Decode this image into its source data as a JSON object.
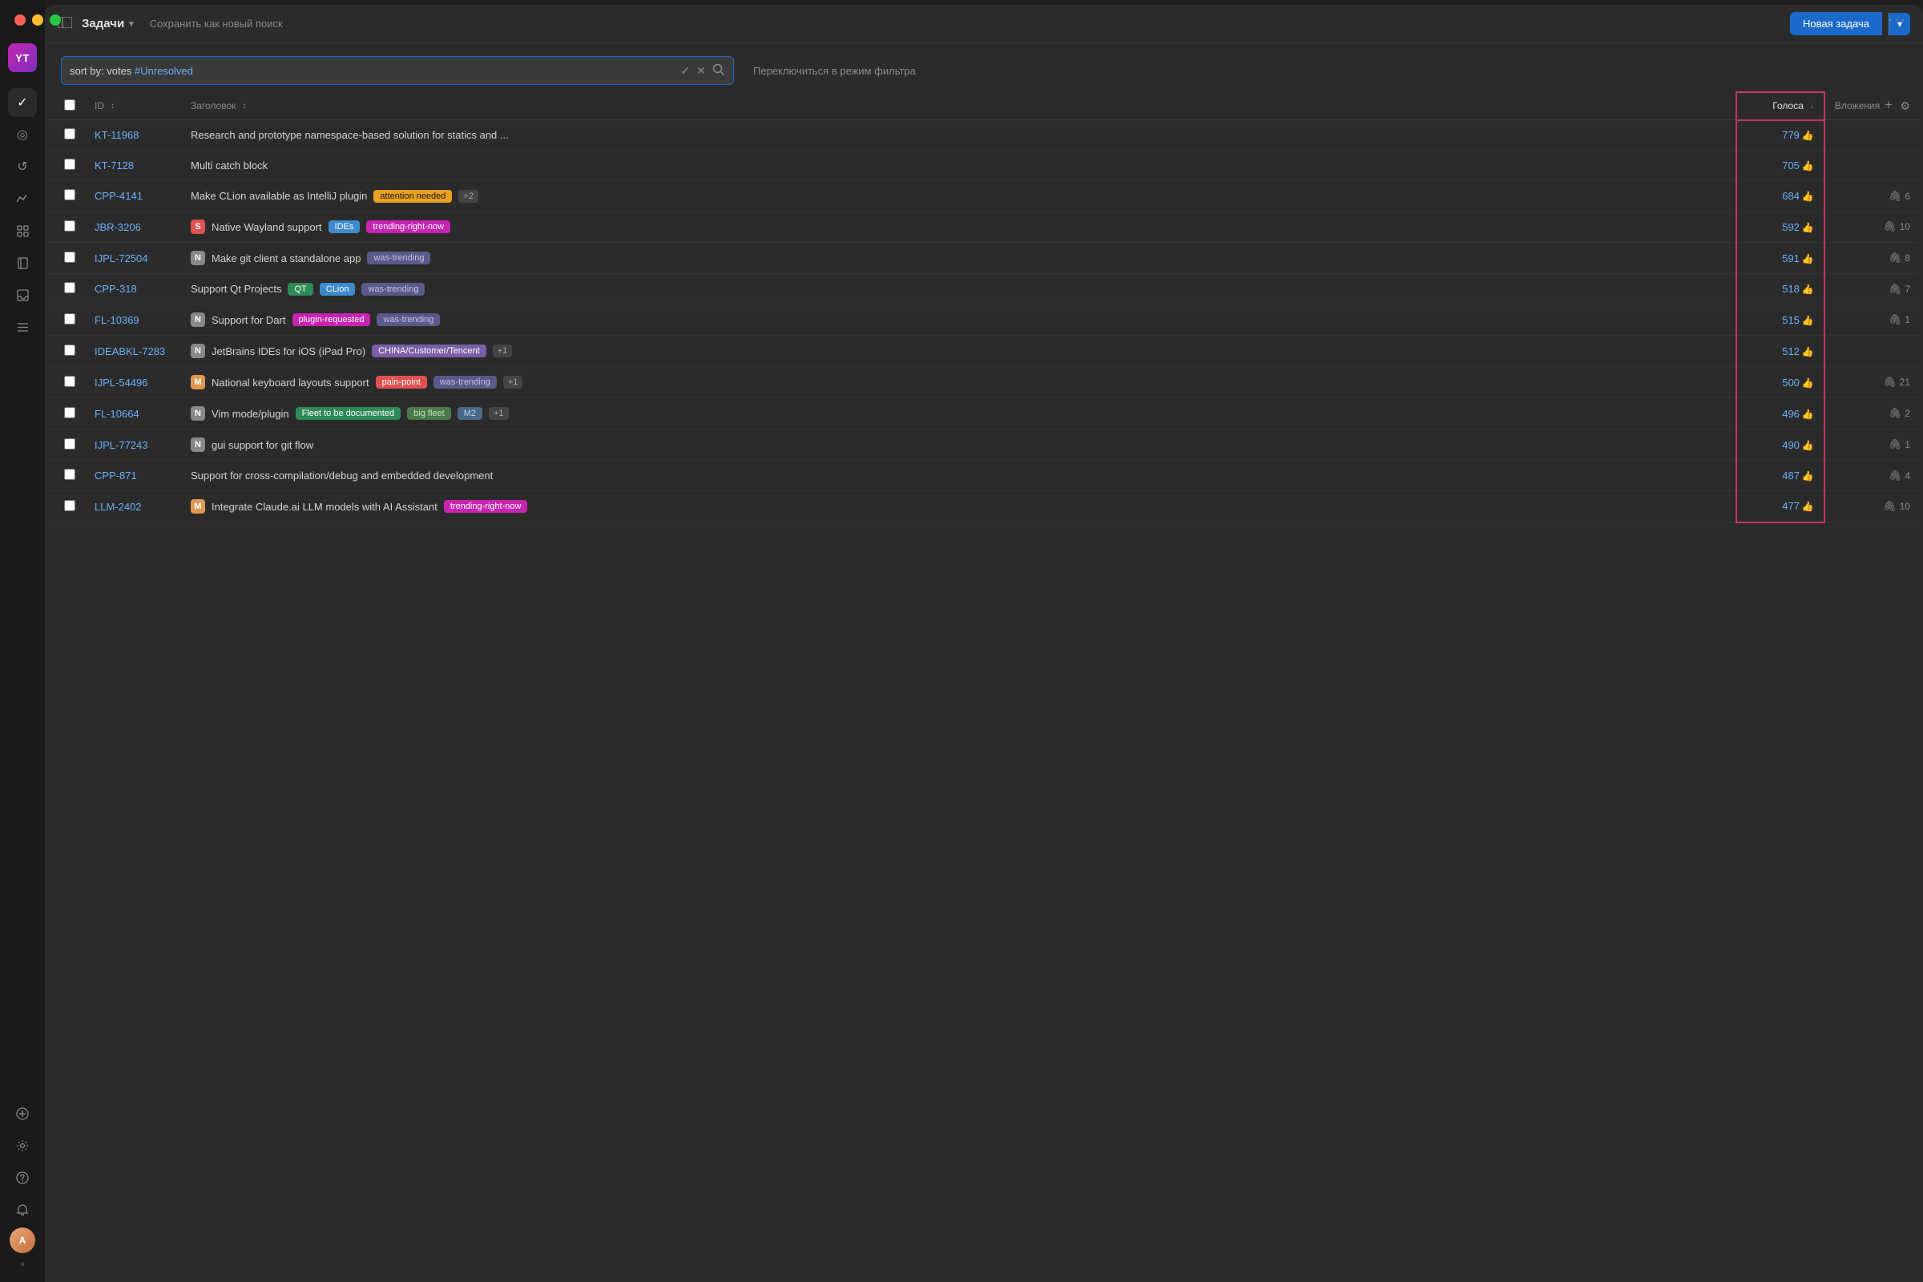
{
  "window": {
    "traffic_lights": [
      "red",
      "yellow",
      "green"
    ]
  },
  "nav": {
    "logo_text": "YT",
    "icons": [
      {
        "name": "checkmark",
        "symbol": "✓",
        "active": true
      },
      {
        "name": "circle",
        "symbol": "◉",
        "active": false
      },
      {
        "name": "history",
        "symbol": "↺",
        "active": false
      },
      {
        "name": "chart",
        "symbol": "⚡",
        "active": false
      },
      {
        "name": "grid",
        "symbol": "⊞",
        "active": false
      },
      {
        "name": "book",
        "symbol": "📖",
        "active": false
      },
      {
        "name": "inbox",
        "symbol": "⊟",
        "active": false
      },
      {
        "name": "stack",
        "symbol": "≡",
        "active": false
      }
    ],
    "bottom_icons": [
      {
        "name": "plus",
        "symbol": "+"
      },
      {
        "name": "settings",
        "symbol": "⚙"
      },
      {
        "name": "question",
        "symbol": "?"
      },
      {
        "name": "bell",
        "symbol": "🔔"
      }
    ],
    "user_initials": "A",
    "expand_icon": "»"
  },
  "topbar": {
    "sidebar_toggle": "⊟",
    "view_title": "Задачи",
    "chevron": "▾",
    "save_search_label": "Сохранить как новый поиск",
    "new_task_label": "Новая задача",
    "new_task_arrow": "▾"
  },
  "search": {
    "query_prefix": "sort by: votes ",
    "query_keyword": "#Unresolved",
    "checkmark_icon": "✓",
    "clear_icon": "✕",
    "search_icon": "🔍",
    "filter_switch_label": "Переключиться в режим фильтра"
  },
  "table": {
    "columns": {
      "checkbox": "",
      "id": "ID",
      "id_sort": "↕",
      "title": "Заголовок",
      "title_sort": "↕",
      "votes": "Голоса",
      "votes_sort": "↓",
      "attach": "Вложения",
      "add": "+",
      "gear": "⚙"
    },
    "rows": [
      {
        "id": "KT-11968",
        "title": "Research and prototype namespace-based solution for statics and ...",
        "tags": [],
        "priority": null,
        "votes": "779",
        "attach": null
      },
      {
        "id": "KT-7128",
        "title": "Multi catch block",
        "tags": [],
        "priority": null,
        "votes": "705",
        "attach": null
      },
      {
        "id": "CPP-4141",
        "title": "Make CLion available as IntelliJ plugin",
        "tags": [
          {
            "label": "attention needed",
            "type": "attention"
          },
          {
            "label": "+2",
            "type": "count"
          }
        ],
        "priority": null,
        "votes": "684",
        "attach": "6"
      },
      {
        "id": "JBR-3206",
        "title": "Native Wayland support",
        "tags": [
          {
            "label": "IDEs",
            "type": "ides"
          },
          {
            "label": "trending-right-now",
            "type": "trending"
          }
        ],
        "priority": "S",
        "priority_type": "s",
        "votes": "592",
        "attach": "10"
      },
      {
        "id": "IJPL-72504",
        "title": "Make git client a standalone app",
        "tags": [
          {
            "label": "was-trending",
            "type": "was-trending"
          }
        ],
        "priority": "N",
        "priority_type": "n",
        "votes": "591",
        "attach": "8"
      },
      {
        "id": "CPP-318",
        "title": "Support Qt Projects",
        "tags": [
          {
            "label": "QT",
            "type": "qt"
          },
          {
            "label": "CLion",
            "type": "clion"
          },
          {
            "label": "was-trending",
            "type": "was-trending"
          }
        ],
        "priority": null,
        "votes": "518",
        "attach": "7"
      },
      {
        "id": "FL-10369",
        "title": "Support for Dart",
        "tags": [
          {
            "label": "plugin-requested",
            "type": "plugin"
          },
          {
            "label": "was-trending",
            "type": "was-trending"
          }
        ],
        "priority": "N",
        "priority_type": "n",
        "votes": "515",
        "attach": "1"
      },
      {
        "id": "IDEABKL-7283",
        "title": "JetBrains IDEs for iOS (iPad Pro)",
        "tags": [
          {
            "label": "CHINA/Customer/Tencent",
            "type": "china"
          },
          {
            "label": "+1",
            "type": "count"
          }
        ],
        "priority": "N",
        "priority_type": "n",
        "votes": "512",
        "attach": null
      },
      {
        "id": "IJPL-54496",
        "title": "National keyboard layouts support",
        "tags": [
          {
            "label": "pain-point",
            "type": "pain"
          },
          {
            "label": "was-trending",
            "type": "was-trending"
          },
          {
            "label": "+1",
            "type": "count"
          }
        ],
        "priority": "M",
        "priority_type": "m",
        "votes": "500",
        "attach": "21"
      },
      {
        "id": "FL-10664",
        "title": "Vim mode/plugin",
        "tags": [
          {
            "label": "Fleet to be documented",
            "type": "fleet-doc"
          },
          {
            "label": "big fleet",
            "type": "big-fleet"
          },
          {
            "label": "M2",
            "type": "m2"
          },
          {
            "label": "+1",
            "type": "count"
          }
        ],
        "priority": "N",
        "priority_type": "n",
        "votes": "496",
        "attach": "2"
      },
      {
        "id": "IJPL-77243",
        "title": "gui support for git flow",
        "tags": [],
        "priority": "N",
        "priority_type": "n",
        "votes": "490",
        "attach": "1"
      },
      {
        "id": "CPP-871",
        "title": "Support for cross-compilation/debug and embedded development",
        "tags": [],
        "priority": null,
        "votes": "487",
        "attach": "4"
      },
      {
        "id": "LLM-2402",
        "title": "Integrate Claude.ai LLM models with AI Assistant",
        "tags": [
          {
            "label": "trending-right-now",
            "type": "trending"
          }
        ],
        "priority": "M",
        "priority_type": "m",
        "votes": "477",
        "attach": "10"
      }
    ]
  }
}
